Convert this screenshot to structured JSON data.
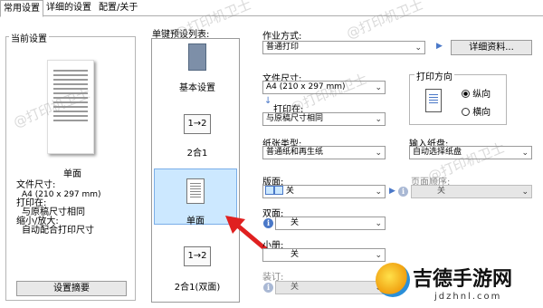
{
  "tabs": [
    "常用设置",
    "详细的设置",
    "配置/关于"
  ],
  "current": {
    "title": "当前设置",
    "caption": "单面",
    "paper_size_label": "文件尺寸:",
    "paper_size_value": "A4 (210 x 297 mm)",
    "print_on_label": "打印在:",
    "print_on_value": "与原稿尺寸相同",
    "zoom_label": "缩小/放大:",
    "zoom_value": "自动配合打印尺寸",
    "summary_button": "设置摘要"
  },
  "presets": {
    "title": "单键预设列表:",
    "items": [
      "基本设置",
      "2合1",
      "单面",
      "2合1(双面)"
    ],
    "icon_text": [
      "1→2",
      "1→2"
    ]
  },
  "output": {
    "label": "作业方式:",
    "value": "普通打印",
    "details_button": "详细资料..."
  },
  "paper_size": {
    "label": "文件尺寸:",
    "value": "A4 (210 x 297 mm)"
  },
  "print_on": {
    "label": "打印在:",
    "value": "与原稿尺寸相同"
  },
  "orientation": {
    "title": "打印方向",
    "options": [
      "纵向",
      "横向"
    ],
    "selected": "纵向"
  },
  "paper_type": {
    "label": "纸张类型:",
    "value": "普通纸和再生纸"
  },
  "paper_source": {
    "label": "输入纸盘:",
    "value": "自动选择纸盘"
  },
  "layout": {
    "label": "版面:",
    "value": "关"
  },
  "page_order": {
    "label": "页面顺序:",
    "value": "关"
  },
  "duplex": {
    "label": "双面:",
    "value": "关"
  },
  "booklet": {
    "label": "小册:",
    "value": "关"
  },
  "staple": {
    "label": "装订:",
    "value": "关"
  },
  "watermark": {
    "text": "@打印机卫士",
    "logo_title": "吉德手游网",
    "logo_url": "jdzhnl.com"
  },
  "colors": {
    "accent": "#4a78c8",
    "selection": "#cce8ff",
    "arrow": "#e02020"
  }
}
